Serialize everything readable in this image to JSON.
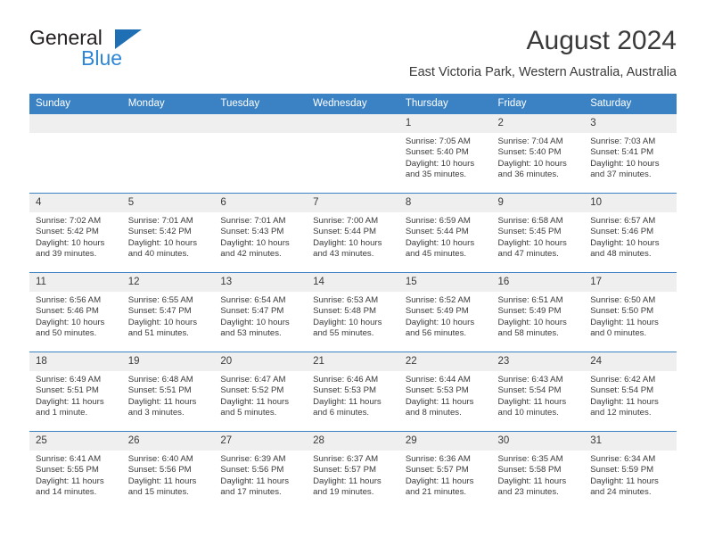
{
  "brand": {
    "name_top": "General",
    "name_bottom": "Blue",
    "triangle_color": "#1f6fb5",
    "blue_color": "#2e86d4"
  },
  "header": {
    "title": "August 2024",
    "subtitle": "East Victoria Park, Western Australia, Australia"
  },
  "colors": {
    "header_row": "#3b82c4",
    "date_band": "#efefef",
    "text": "#3a3a3a"
  },
  "weekdays": [
    "Sunday",
    "Monday",
    "Tuesday",
    "Wednesday",
    "Thursday",
    "Friday",
    "Saturday"
  ],
  "weeks": [
    [
      {
        "day": "",
        "sunrise": "",
        "sunset": "",
        "daylight_line1": "",
        "daylight_line2": ""
      },
      {
        "day": "",
        "sunrise": "",
        "sunset": "",
        "daylight_line1": "",
        "daylight_line2": ""
      },
      {
        "day": "",
        "sunrise": "",
        "sunset": "",
        "daylight_line1": "",
        "daylight_line2": ""
      },
      {
        "day": "",
        "sunrise": "",
        "sunset": "",
        "daylight_line1": "",
        "daylight_line2": ""
      },
      {
        "day": "1",
        "sunrise": "Sunrise: 7:05 AM",
        "sunset": "Sunset: 5:40 PM",
        "daylight_line1": "Daylight: 10 hours",
        "daylight_line2": "and 35 minutes."
      },
      {
        "day": "2",
        "sunrise": "Sunrise: 7:04 AM",
        "sunset": "Sunset: 5:40 PM",
        "daylight_line1": "Daylight: 10 hours",
        "daylight_line2": "and 36 minutes."
      },
      {
        "day": "3",
        "sunrise": "Sunrise: 7:03 AM",
        "sunset": "Sunset: 5:41 PM",
        "daylight_line1": "Daylight: 10 hours",
        "daylight_line2": "and 37 minutes."
      }
    ],
    [
      {
        "day": "4",
        "sunrise": "Sunrise: 7:02 AM",
        "sunset": "Sunset: 5:42 PM",
        "daylight_line1": "Daylight: 10 hours",
        "daylight_line2": "and 39 minutes."
      },
      {
        "day": "5",
        "sunrise": "Sunrise: 7:01 AM",
        "sunset": "Sunset: 5:42 PM",
        "daylight_line1": "Daylight: 10 hours",
        "daylight_line2": "and 40 minutes."
      },
      {
        "day": "6",
        "sunrise": "Sunrise: 7:01 AM",
        "sunset": "Sunset: 5:43 PM",
        "daylight_line1": "Daylight: 10 hours",
        "daylight_line2": "and 42 minutes."
      },
      {
        "day": "7",
        "sunrise": "Sunrise: 7:00 AM",
        "sunset": "Sunset: 5:44 PM",
        "daylight_line1": "Daylight: 10 hours",
        "daylight_line2": "and 43 minutes."
      },
      {
        "day": "8",
        "sunrise": "Sunrise: 6:59 AM",
        "sunset": "Sunset: 5:44 PM",
        "daylight_line1": "Daylight: 10 hours",
        "daylight_line2": "and 45 minutes."
      },
      {
        "day": "9",
        "sunrise": "Sunrise: 6:58 AM",
        "sunset": "Sunset: 5:45 PM",
        "daylight_line1": "Daylight: 10 hours",
        "daylight_line2": "and 47 minutes."
      },
      {
        "day": "10",
        "sunrise": "Sunrise: 6:57 AM",
        "sunset": "Sunset: 5:46 PM",
        "daylight_line1": "Daylight: 10 hours",
        "daylight_line2": "and 48 minutes."
      }
    ],
    [
      {
        "day": "11",
        "sunrise": "Sunrise: 6:56 AM",
        "sunset": "Sunset: 5:46 PM",
        "daylight_line1": "Daylight: 10 hours",
        "daylight_line2": "and 50 minutes."
      },
      {
        "day": "12",
        "sunrise": "Sunrise: 6:55 AM",
        "sunset": "Sunset: 5:47 PM",
        "daylight_line1": "Daylight: 10 hours",
        "daylight_line2": "and 51 minutes."
      },
      {
        "day": "13",
        "sunrise": "Sunrise: 6:54 AM",
        "sunset": "Sunset: 5:47 PM",
        "daylight_line1": "Daylight: 10 hours",
        "daylight_line2": "and 53 minutes."
      },
      {
        "day": "14",
        "sunrise": "Sunrise: 6:53 AM",
        "sunset": "Sunset: 5:48 PM",
        "daylight_line1": "Daylight: 10 hours",
        "daylight_line2": "and 55 minutes."
      },
      {
        "day": "15",
        "sunrise": "Sunrise: 6:52 AM",
        "sunset": "Sunset: 5:49 PM",
        "daylight_line1": "Daylight: 10 hours",
        "daylight_line2": "and 56 minutes."
      },
      {
        "day": "16",
        "sunrise": "Sunrise: 6:51 AM",
        "sunset": "Sunset: 5:49 PM",
        "daylight_line1": "Daylight: 10 hours",
        "daylight_line2": "and 58 minutes."
      },
      {
        "day": "17",
        "sunrise": "Sunrise: 6:50 AM",
        "sunset": "Sunset: 5:50 PM",
        "daylight_line1": "Daylight: 11 hours",
        "daylight_line2": "and 0 minutes."
      }
    ],
    [
      {
        "day": "18",
        "sunrise": "Sunrise: 6:49 AM",
        "sunset": "Sunset: 5:51 PM",
        "daylight_line1": "Daylight: 11 hours",
        "daylight_line2": "and 1 minute."
      },
      {
        "day": "19",
        "sunrise": "Sunrise: 6:48 AM",
        "sunset": "Sunset: 5:51 PM",
        "daylight_line1": "Daylight: 11 hours",
        "daylight_line2": "and 3 minutes."
      },
      {
        "day": "20",
        "sunrise": "Sunrise: 6:47 AM",
        "sunset": "Sunset: 5:52 PM",
        "daylight_line1": "Daylight: 11 hours",
        "daylight_line2": "and 5 minutes."
      },
      {
        "day": "21",
        "sunrise": "Sunrise: 6:46 AM",
        "sunset": "Sunset: 5:53 PM",
        "daylight_line1": "Daylight: 11 hours",
        "daylight_line2": "and 6 minutes."
      },
      {
        "day": "22",
        "sunrise": "Sunrise: 6:44 AM",
        "sunset": "Sunset: 5:53 PM",
        "daylight_line1": "Daylight: 11 hours",
        "daylight_line2": "and 8 minutes."
      },
      {
        "day": "23",
        "sunrise": "Sunrise: 6:43 AM",
        "sunset": "Sunset: 5:54 PM",
        "daylight_line1": "Daylight: 11 hours",
        "daylight_line2": "and 10 minutes."
      },
      {
        "day": "24",
        "sunrise": "Sunrise: 6:42 AM",
        "sunset": "Sunset: 5:54 PM",
        "daylight_line1": "Daylight: 11 hours",
        "daylight_line2": "and 12 minutes."
      }
    ],
    [
      {
        "day": "25",
        "sunrise": "Sunrise: 6:41 AM",
        "sunset": "Sunset: 5:55 PM",
        "daylight_line1": "Daylight: 11 hours",
        "daylight_line2": "and 14 minutes."
      },
      {
        "day": "26",
        "sunrise": "Sunrise: 6:40 AM",
        "sunset": "Sunset: 5:56 PM",
        "daylight_line1": "Daylight: 11 hours",
        "daylight_line2": "and 15 minutes."
      },
      {
        "day": "27",
        "sunrise": "Sunrise: 6:39 AM",
        "sunset": "Sunset: 5:56 PM",
        "daylight_line1": "Daylight: 11 hours",
        "daylight_line2": "and 17 minutes."
      },
      {
        "day": "28",
        "sunrise": "Sunrise: 6:37 AM",
        "sunset": "Sunset: 5:57 PM",
        "daylight_line1": "Daylight: 11 hours",
        "daylight_line2": "and 19 minutes."
      },
      {
        "day": "29",
        "sunrise": "Sunrise: 6:36 AM",
        "sunset": "Sunset: 5:57 PM",
        "daylight_line1": "Daylight: 11 hours",
        "daylight_line2": "and 21 minutes."
      },
      {
        "day": "30",
        "sunrise": "Sunrise: 6:35 AM",
        "sunset": "Sunset: 5:58 PM",
        "daylight_line1": "Daylight: 11 hours",
        "daylight_line2": "and 23 minutes."
      },
      {
        "day": "31",
        "sunrise": "Sunrise: 6:34 AM",
        "sunset": "Sunset: 5:59 PM",
        "daylight_line1": "Daylight: 11 hours",
        "daylight_line2": "and 24 minutes."
      }
    ]
  ]
}
